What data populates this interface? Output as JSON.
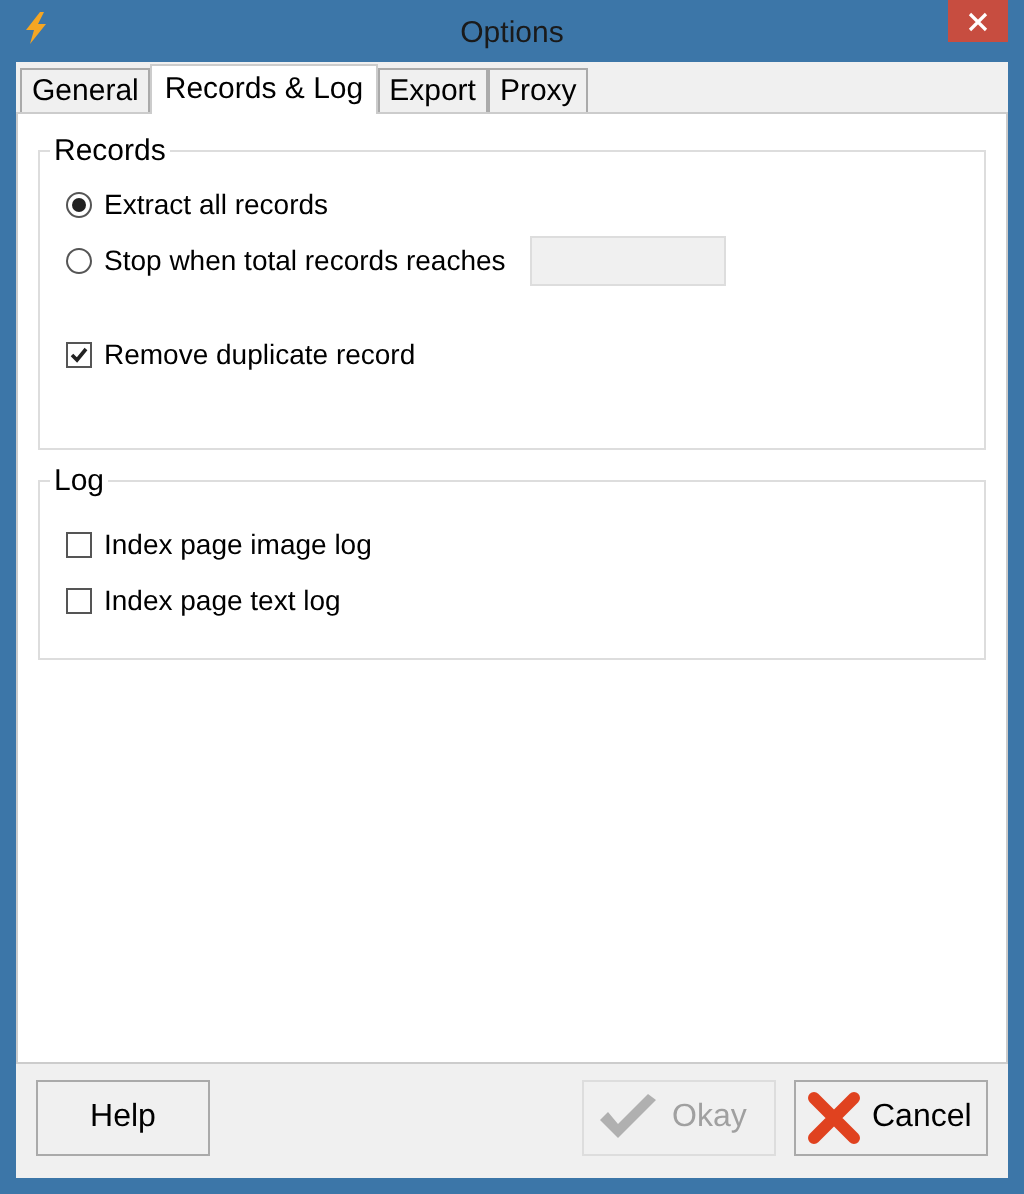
{
  "window": {
    "title": "Options"
  },
  "tabs": [
    {
      "label": "General",
      "selected": false
    },
    {
      "label": "Records & Log",
      "selected": true
    },
    {
      "label": "Export",
      "selected": false
    },
    {
      "label": "Proxy",
      "selected": false
    }
  ],
  "records": {
    "title": "Records",
    "options": [
      {
        "label": "Extract all records",
        "selected": true
      },
      {
        "label": "Stop when total records reaches",
        "selected": false
      }
    ],
    "limit_field": {
      "disabled": true
    },
    "remove_duplicate": {
      "label": "Remove duplicate record",
      "checked": true
    }
  },
  "log": {
    "title": "Log",
    "items": [
      {
        "label": "Index page image log",
        "checked": false
      },
      {
        "label": "Index page text log",
        "checked": false
      }
    ]
  },
  "buttons": [
    {
      "kind": "help",
      "label": "Help",
      "disabled": false
    },
    {
      "kind": "okay",
      "label": "Okay",
      "disabled": true
    },
    {
      "kind": "cancel",
      "label": "Cancel",
      "disabled": false
    }
  ]
}
